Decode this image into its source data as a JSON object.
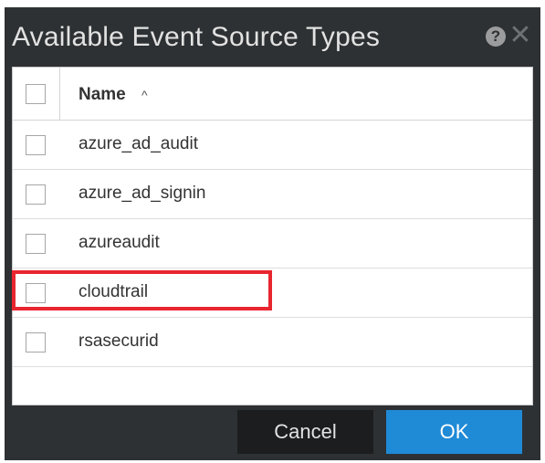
{
  "dialog": {
    "title": "Available Event Source Types",
    "help_icon_glyph": "?",
    "close_icon_glyph": "✕"
  },
  "table": {
    "column_header": "Name",
    "sort_glyph": "^",
    "rows": [
      {
        "label": "azure_ad_audit",
        "checked": false
      },
      {
        "label": "azure_ad_signin",
        "checked": false
      },
      {
        "label": "azureaudit",
        "checked": false
      },
      {
        "label": "cloudtrail",
        "checked": false
      },
      {
        "label": "rsasecurid",
        "checked": false,
        "highlighted": true
      }
    ]
  },
  "buttons": {
    "cancel_label": "Cancel",
    "ok_label": "OK"
  },
  "colors": {
    "dialog_background": "#2e3133",
    "ok_button": "#1f8ad6",
    "cancel_button": "#1b1d1e",
    "highlight": "#e8262f"
  },
  "icons": {
    "help": "help-circle-icon",
    "close": "close-icon",
    "sort": "sort-ascending-icon"
  }
}
